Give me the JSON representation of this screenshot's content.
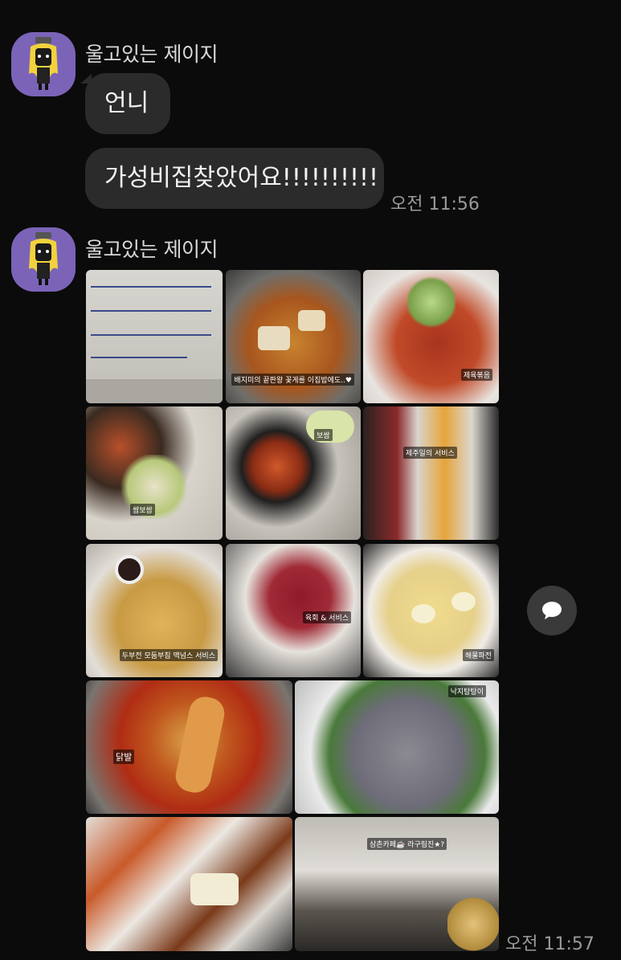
{
  "messages": [
    {
      "sender": "울고있는 제이지",
      "bubbles": [
        "언니",
        "가성비집찾았어요!!!!!!!!!!"
      ],
      "time": "오전 11:56"
    },
    {
      "sender": "울고있는 제이지",
      "photos": [
        {
          "name": "menu-photo",
          "caption": ""
        },
        {
          "name": "stew-photo",
          "caption": "배지미의 끝판왕 꽃게를 이집밥에도..♥"
        },
        {
          "name": "stir-fry-photo",
          "caption": "제육볶음"
        },
        {
          "name": "wrap-photo",
          "caption": "쌈보쌈"
        },
        {
          "name": "jjigae-photo",
          "caption": "보쌈"
        },
        {
          "name": "side-dish-photo",
          "caption": "제주일의 서비스"
        },
        {
          "name": "jeon-photo",
          "caption": "두부전 모둠부침 맥넘스 서비스"
        },
        {
          "name": "raw-beef-photo",
          "caption": "육회 & 서비스"
        },
        {
          "name": "pancake-photo",
          "caption": "해물파전"
        },
        {
          "name": "braised-chicken-photo",
          "caption": "닭발"
        },
        {
          "name": "octopus-photo",
          "caption": "낙지탕탕이"
        },
        {
          "name": "banchan-photo",
          "caption": ""
        },
        {
          "name": "cafe-photo",
          "caption": "삼촌카페☕️ 라구림진★?"
        }
      ],
      "time": "오전 11:57"
    }
  ],
  "colors": {
    "background": "#0b0b0b",
    "bubble": "#2b2b2b",
    "avatar": "#7b64b8"
  },
  "icons": {
    "share": "speech-bubble-icon"
  }
}
